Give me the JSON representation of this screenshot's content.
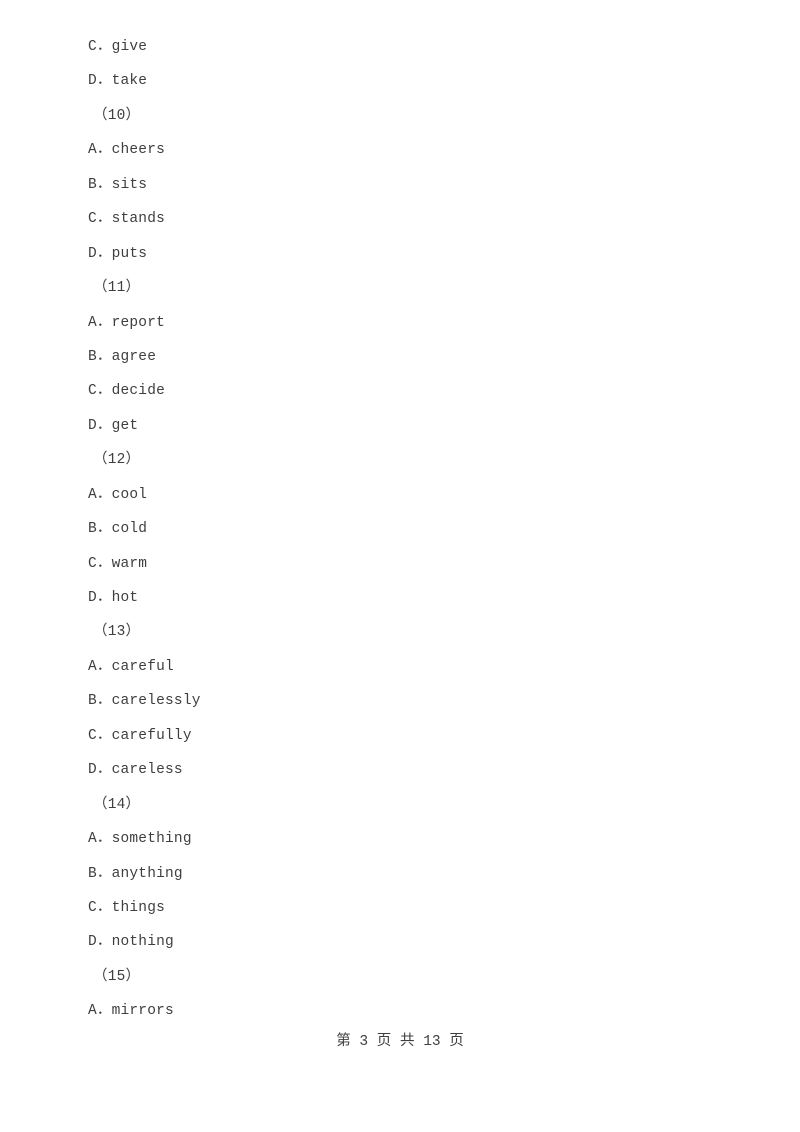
{
  "document": {
    "type": "exam-paper",
    "language": "zh-CN",
    "text_color": "#3f3f3f",
    "background_color": "#ffffff"
  },
  "body_lines": [
    {
      "kind": "option",
      "text": "C．give"
    },
    {
      "kind": "option",
      "text": "D．take"
    },
    {
      "kind": "qnum",
      "text": "（10）"
    },
    {
      "kind": "option",
      "text": "A．cheers"
    },
    {
      "kind": "option",
      "text": "B．sits"
    },
    {
      "kind": "option",
      "text": "C．stands"
    },
    {
      "kind": "option",
      "text": "D．puts"
    },
    {
      "kind": "qnum",
      "text": "（11）"
    },
    {
      "kind": "option",
      "text": "A．report"
    },
    {
      "kind": "option",
      "text": "B．agree"
    },
    {
      "kind": "option",
      "text": "C．decide"
    },
    {
      "kind": "option",
      "text": "D．get"
    },
    {
      "kind": "qnum",
      "text": "（12）"
    },
    {
      "kind": "option",
      "text": "A．cool"
    },
    {
      "kind": "option",
      "text": "B．cold"
    },
    {
      "kind": "option",
      "text": "C．warm"
    },
    {
      "kind": "option",
      "text": "D．hot"
    },
    {
      "kind": "qnum",
      "text": "（13）"
    },
    {
      "kind": "option",
      "text": "A．careful"
    },
    {
      "kind": "option",
      "text": "B．carelessly"
    },
    {
      "kind": "option",
      "text": "C．carefully"
    },
    {
      "kind": "option",
      "text": "D．careless"
    },
    {
      "kind": "qnum",
      "text": "（14）"
    },
    {
      "kind": "option",
      "text": "A．something"
    },
    {
      "kind": "option",
      "text": "B．anything"
    },
    {
      "kind": "option",
      "text": "C．things"
    },
    {
      "kind": "option",
      "text": "D．nothing"
    },
    {
      "kind": "qnum",
      "text": "（15）"
    },
    {
      "kind": "option",
      "text": "A．mirrors"
    }
  ],
  "footer": {
    "text": "第 3 页 共 13 页",
    "current_page": "3",
    "total_pages": "13"
  }
}
